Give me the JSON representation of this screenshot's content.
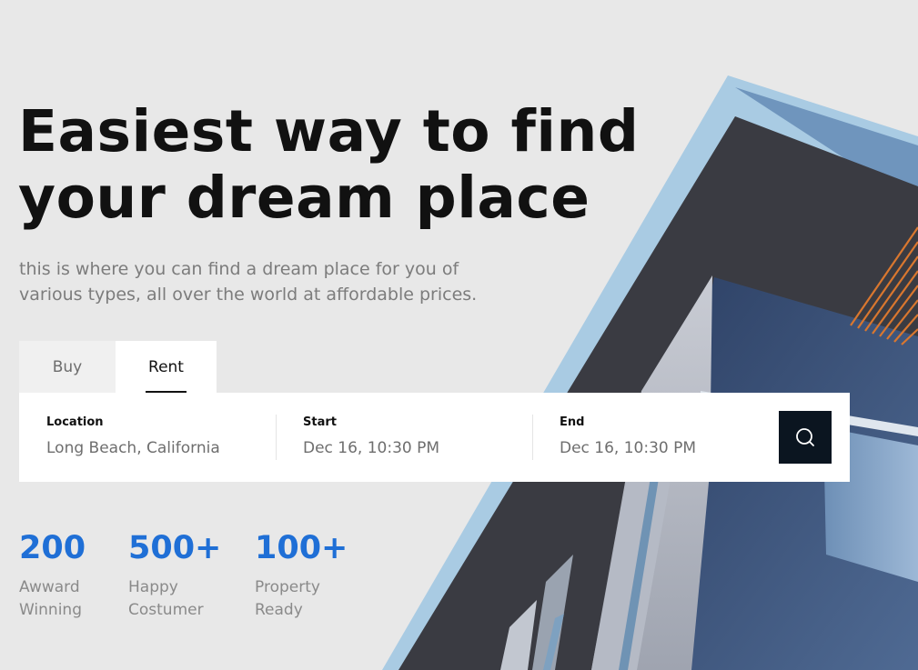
{
  "hero": {
    "title_line1": "Easiest way to find",
    "title_line2": "your dream place",
    "subtitle_line1": "this is where you can find a dream place for you of",
    "subtitle_line2": "various types, all over the world at affordable prices."
  },
  "tabs": [
    {
      "label": "Buy",
      "active": false
    },
    {
      "label": "Rent",
      "active": true
    }
  ],
  "search": {
    "location_label": "Location",
    "location_value": "Long Beach, California",
    "start_label": "Start",
    "start_value": "Dec 16, 10:30 PM",
    "end_label": "End",
    "end_value": "Dec 16, 10:30 PM",
    "button_icon": "search-icon"
  },
  "stats": [
    {
      "value": "200",
      "label_line1": "Awward",
      "label_line2": "Winning"
    },
    {
      "value": "500+",
      "label_line1": "Happy",
      "label_line2": "Costumer"
    },
    {
      "value": "100+",
      "label_line1": "Property",
      "label_line2": "Ready"
    }
  ],
  "colors": {
    "background": "#e8e8e8",
    "accent_blue": "#1f6fd6",
    "search_button": "#0b1520",
    "building_orange": "#d9772f"
  }
}
